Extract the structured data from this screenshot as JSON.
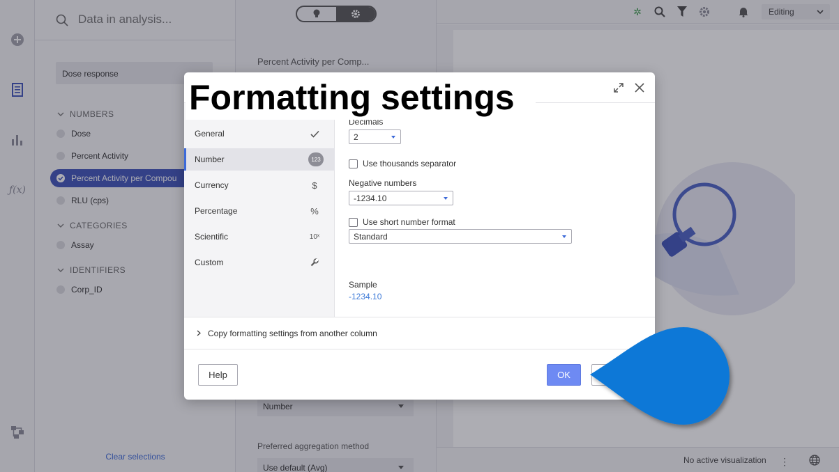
{
  "search": {
    "placeholder": "Data in analysis..."
  },
  "data_table": {
    "name": "Dose response"
  },
  "groups": {
    "numbers": "NUMBERS",
    "categories": "CATEGORIES",
    "identifiers": "IDENTIFIERS"
  },
  "columns": {
    "dose": "Dose",
    "percent_activity": "Percent Activity",
    "percent_activity_per_compound": "Percent Activity per Compou",
    "rlu": "RLU (cps)",
    "assay": "Assay",
    "corp_id": "Corp_ID"
  },
  "data_panel": {
    "clear_selections": "Clear selections"
  },
  "properties": {
    "column_title": "Percent Activity per Comp...",
    "data_type": "Number",
    "aggregation_label": "Preferred aggregation method",
    "aggregation_value": "Use default (Avg)"
  },
  "topbar": {
    "mode": "Editing"
  },
  "statusbar": {
    "text": "No active visualization"
  },
  "dialog": {
    "nav": [
      {
        "label": "General",
        "icon": "check-icon"
      },
      {
        "label": "Number",
        "icon": "number-badge-icon",
        "badge": "123"
      },
      {
        "label": "Currency",
        "icon": "dollar-icon",
        "glyph": "$"
      },
      {
        "label": "Percentage",
        "icon": "percent-icon",
        "glyph": "%"
      },
      {
        "label": "Scientific",
        "icon": "scientific-icon",
        "glyph": "10ˣ"
      },
      {
        "label": "Custom",
        "icon": "wrench-icon"
      }
    ],
    "decimals_label": "Decimals",
    "decimals_value": "2",
    "thousands_label": "Use thousands separator",
    "negative_label": "Negative numbers",
    "negative_value": "-1234.10",
    "short_format_label": "Use short number format",
    "short_format_value": "Standard",
    "sample_label": "Sample",
    "sample_value": "-1234.10",
    "copy_label": "Copy formatting settings from another column",
    "help_label": "Help",
    "ok_label": "OK"
  },
  "annotation": {
    "caption": "Formatting settings"
  },
  "colors": {
    "accent": "#3d52b8",
    "link": "#3d7ad8",
    "ok_button": "#6e8af3",
    "pointer": "#0a78d7"
  }
}
